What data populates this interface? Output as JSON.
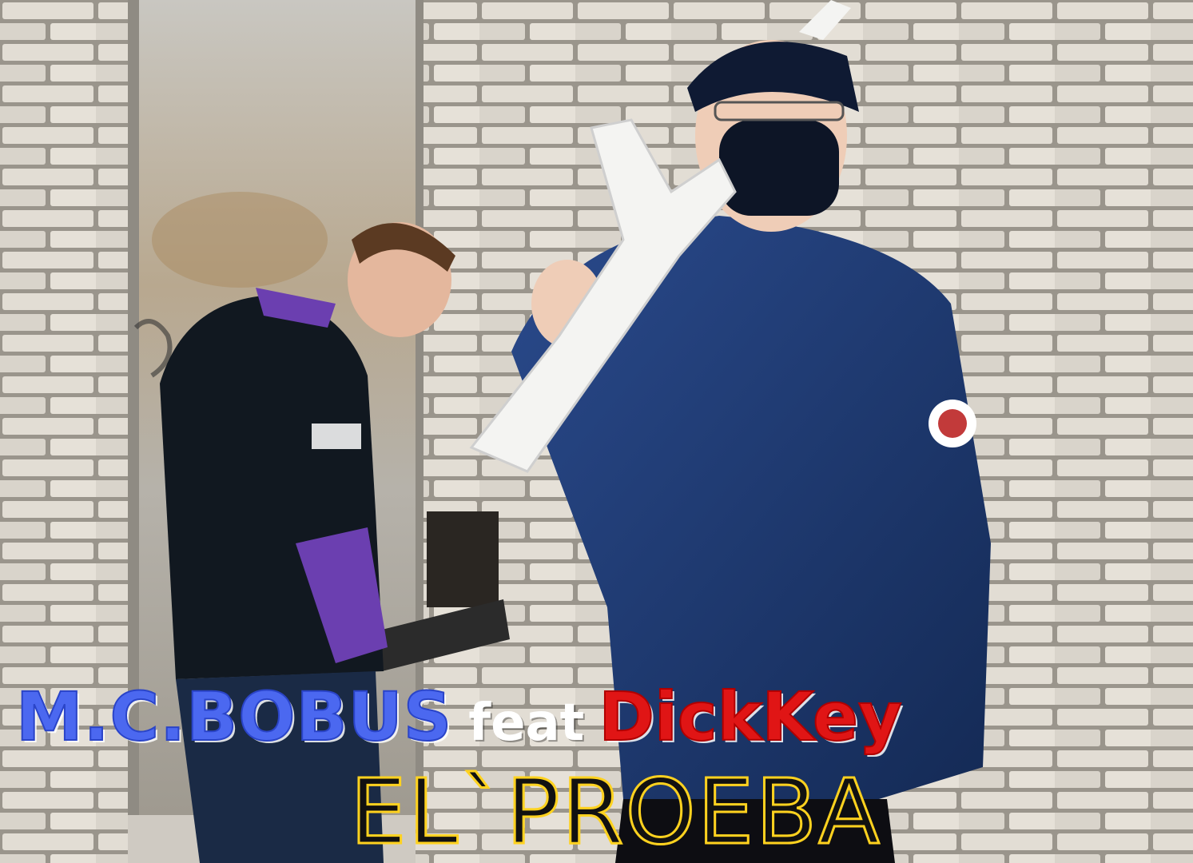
{
  "cover": {
    "artist_primary": "M.C.BOBUS",
    "feat_word": "feat",
    "artist_featured": "DickKey",
    "song_title": "EL`PROEBA"
  },
  "colors": {
    "artist_primary": "#4b68f0",
    "feat_word": "#ffffff",
    "artist_featured": "#e01515",
    "song_title_outline": "#ffd21f",
    "wall": "#dcd7cf",
    "door": "#b9b6ae",
    "hoodie": "#101820",
    "jacket": "#1f3b73"
  }
}
